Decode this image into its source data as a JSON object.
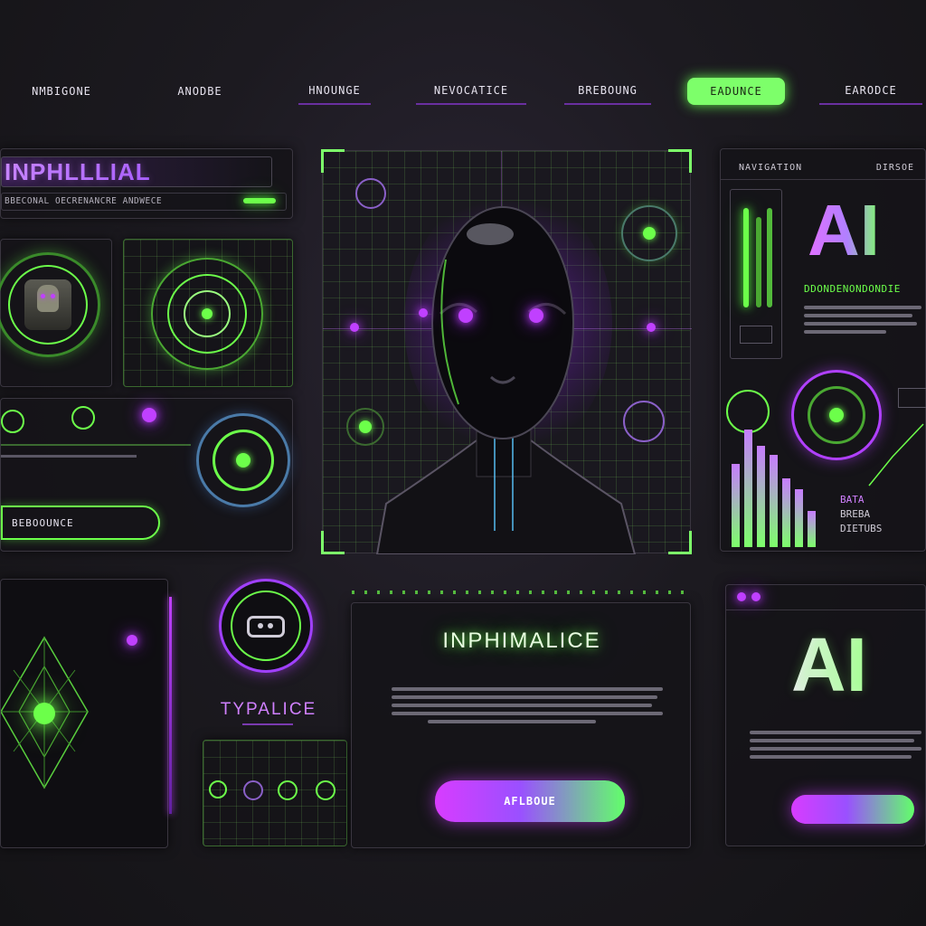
{
  "nav": {
    "items": [
      {
        "label": "NMBIGONE"
      },
      {
        "label": "ANODBE"
      },
      {
        "label": "HNOUNGE"
      },
      {
        "label": "NEVOCATICE"
      },
      {
        "label": "BREBOUNG"
      },
      {
        "label": "EADUNCE",
        "active": true
      },
      {
        "label": "EARODCE"
      }
    ]
  },
  "left_top": {
    "title": "INPHLLLIAL",
    "subtitle": "BBECONAL OECRENANCRE ANDWECE"
  },
  "left_mid": {
    "button_label": "BEBOOUNCE"
  },
  "bottom_left": {
    "label": "TYPALICE"
  },
  "center": {
    "heading": "INPHIMALICE",
    "button_label": "AFLBOUE"
  },
  "right_top": {
    "tab1": "NAVIGATION",
    "tab2": "DIRSOE",
    "ai_label": "AI",
    "caption": "DDONDENONDONDIE",
    "stats": [
      "BATA",
      "BREBA",
      "DIETUBS"
    ]
  },
  "right_bottom": {
    "ai_label": "AI"
  },
  "colors": {
    "accent_green": "#7dff6a",
    "accent_purple": "#c040ff",
    "background": "#1c1a20"
  }
}
